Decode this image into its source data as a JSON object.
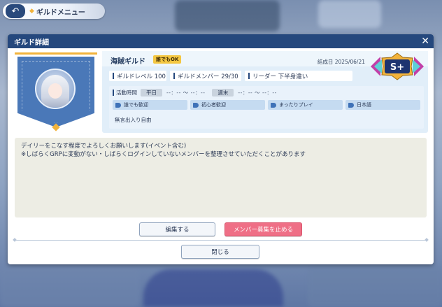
{
  "topbar": {
    "title": "ギルドメニュー",
    "back_icon": "back-arrow-icon"
  },
  "modal": {
    "title": "ギルド詳細",
    "close_icon": "close-icon"
  },
  "guild": {
    "name": "海賊ギルド",
    "badge": "誰でもOK",
    "founded": "結成日 2025/06/21",
    "rank": "S+",
    "level": "ギルドレベル 100",
    "members": "ギルドメンバー 29/30",
    "leader": "リーダー 下半身違い",
    "activity_label": "活動時間",
    "weekday_label": "平日",
    "weekday_time": "--：-- 〜 --：--",
    "weekend_label": "週末",
    "weekend_time": "--：-- 〜 --：--",
    "tags": [
      "誰でも歓迎",
      "初心者歓迎",
      "まったりプレイ",
      "日本語"
    ],
    "join_policy": "無言出入り自由"
  },
  "description": {
    "line1": "デイリーをこなす程度でよろしくお願いします(イベント含む)",
    "line2": "※しばらくGRPに変動がない・しばらくログインしていないメンバーを整理させていただくことがあります"
  },
  "buttons": {
    "edit": "編集する",
    "stop_recruit": "メンバー募集を止める",
    "close": "閉じる"
  },
  "colors": {
    "header": "#25487d",
    "accent_gold": "#f2b33b",
    "stop_button": "#ef6f86",
    "emblem": "#4a78b8"
  }
}
